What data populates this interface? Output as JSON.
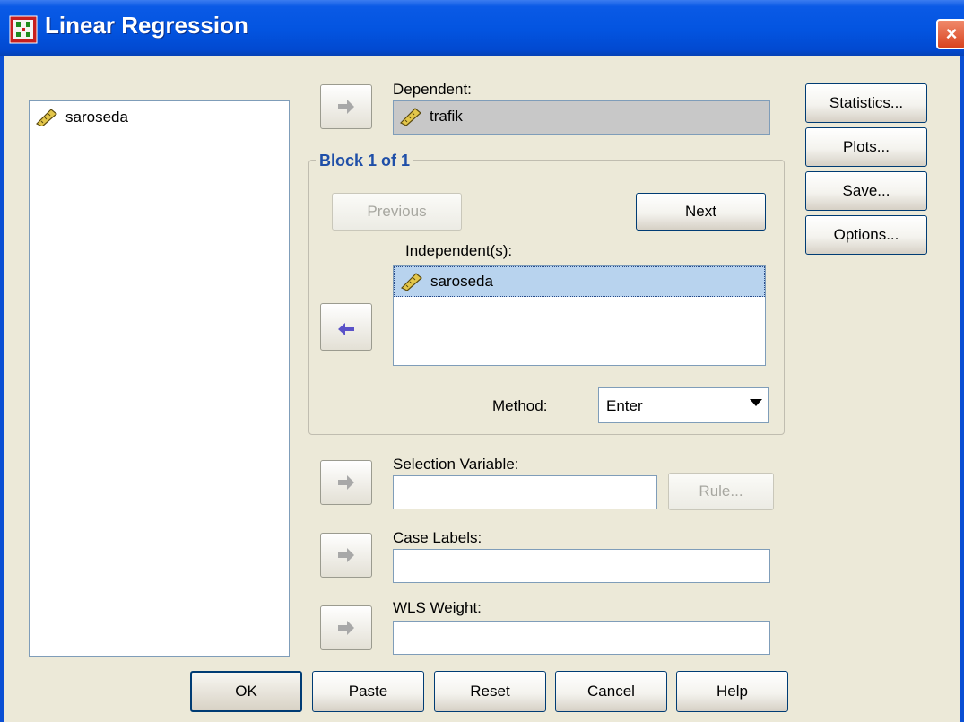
{
  "window": {
    "title": "Linear Regression",
    "close": "×"
  },
  "source_list": {
    "items": [
      {
        "label": "saroseda",
        "icon": "scale-ruler-icon"
      }
    ]
  },
  "dependent": {
    "label": "Dependent:",
    "value": "trafik"
  },
  "block": {
    "title": "Block 1 of 1",
    "previous_label": "Previous",
    "next_label": "Next",
    "independents_label": "Independent(s):",
    "independents": [
      {
        "label": "saroseda",
        "icon": "scale-ruler-icon"
      }
    ],
    "method_label": "Method:",
    "method_value": "Enter"
  },
  "selection": {
    "label": "Selection Variable:",
    "value": "",
    "rule_label": "Rule..."
  },
  "case_labels": {
    "label": "Case Labels:",
    "value": ""
  },
  "wls": {
    "label": "WLS Weight:",
    "value": ""
  },
  "side_buttons": {
    "statistics": "Statistics...",
    "plots": "Plots...",
    "save": "Save...",
    "options": "Options..."
  },
  "bottom_buttons": {
    "ok": "OK",
    "paste": "Paste",
    "reset": "Reset",
    "cancel": "Cancel",
    "help": "Help"
  },
  "colors": {
    "title_bar": "#0354e0",
    "dialog_bg": "#ece9d8",
    "selection": "#b8d3ee",
    "group_title": "#1f4fa8"
  }
}
